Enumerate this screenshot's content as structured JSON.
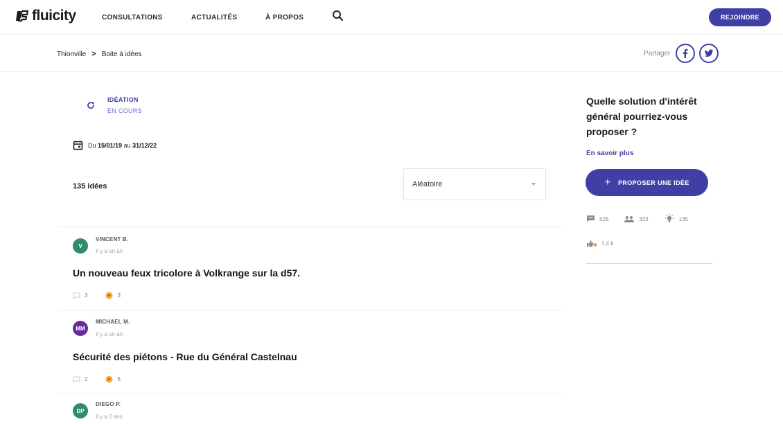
{
  "header": {
    "logo_text": "fluicity",
    "nav": [
      "CONSULTATIONS",
      "ACTUALITÉS",
      "À PROPOS"
    ],
    "join_label": "REJOINDRE",
    "brand_color": "#3f3fa6"
  },
  "breadcrumb": {
    "items": [
      "Thionville",
      "Boite à idées"
    ],
    "separator": ">"
  },
  "share": {
    "label": "Partager",
    "icons": [
      "facebook-icon",
      "twitter-icon"
    ]
  },
  "status": {
    "title": "IDÉATION",
    "subtitle": "EN COURS"
  },
  "dates": {
    "prefix": "Du",
    "start": "15/01/19",
    "middle": "au",
    "end": "31/12/22"
  },
  "list": {
    "count_label": "135 idées",
    "sort_value": "Aléatoire"
  },
  "ideas": [
    {
      "initials": "V",
      "avatar_color": "#2e8b6e",
      "author": "VINCENT B.",
      "time": "Il y a un an",
      "title": "Un nouveau feux tricolore à Volkrange sur la d57.",
      "comments": "3",
      "votes": "3"
    },
    {
      "initials": "MM",
      "avatar_color": "#6a2a9e",
      "author": "MICHAEL M.",
      "time": "Il y a un an",
      "title": "Sécurité des piétons - Rue du Général Castelnau",
      "comments": "2",
      "votes": "6"
    },
    {
      "initials": "DP",
      "avatar_color": "#2e8b6e",
      "author": "DIEGO P.",
      "time": "Il y a 2 ans",
      "title": "",
      "comments": "",
      "votes": ""
    }
  ],
  "sidebar": {
    "question": "Quelle solution d'intérêt général pourriez-vous proposer ?",
    "more_label": "En savoir plus",
    "propose_label": "PROPOSER UNE IDÉE",
    "stats": {
      "comments": "626",
      "participants": "333",
      "ideas": "135",
      "votes": "1,4 k"
    }
  }
}
